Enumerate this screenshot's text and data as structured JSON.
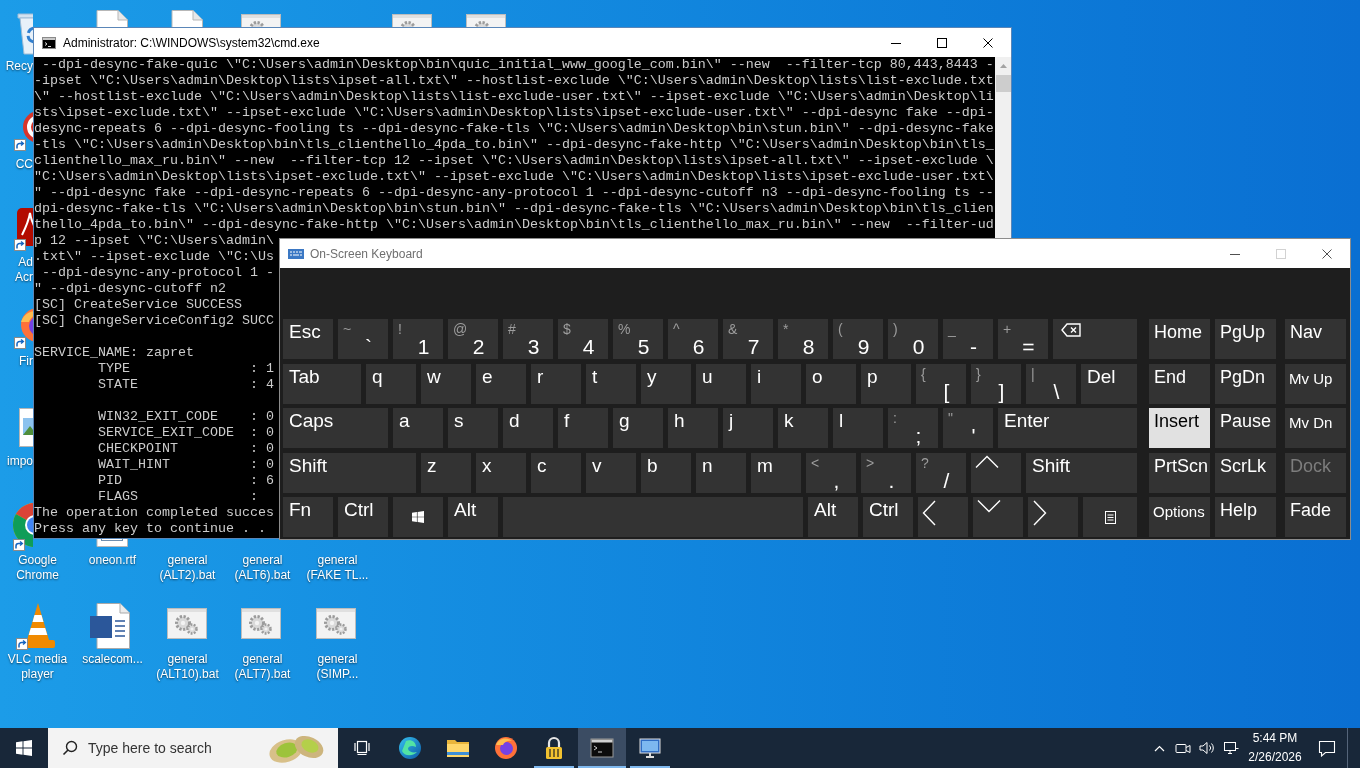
{
  "desktop": {
    "icons": [
      {
        "label": "Recy"
      },
      {
        "label": "CC"
      },
      {
        "label": "Ad Acr"
      },
      {
        "label": "Fir"
      },
      {
        "label": "impo"
      },
      {
        "label": "Google Chrome"
      },
      {
        "label": "VLC media player"
      },
      {
        "label": "oneon.rtf"
      },
      {
        "label": "scalecom..."
      },
      {
        "label": "general (ALT2).bat"
      },
      {
        "label": "general (ALT10).bat"
      },
      {
        "label": "general (ALT6).bat"
      },
      {
        "label": "general (ALT7).bat"
      },
      {
        "label": "general (FAKE TL..."
      },
      {
        "label": "general (SIMP..."
      }
    ]
  },
  "console_window": {
    "title": "Administrator: C:\\WINDOWS\\system32\\cmd.exe",
    "blocks": [
      [
        " --dpi-desync-fake-quic \\\"C:\\Users\\admin\\Desktop\\bin\\quic_initial_www_google_com.bin\\\" --new  --filter-tcp 80,443,8443 -",
        "-ipset \\\"C:\\Users\\admin\\Desktop\\lists\\ipset-all.txt\\\" --hostlist-exclude \\\"C:\\Users\\admin\\Desktop\\lists\\list-exclude.txt",
        "\\\" --hostlist-exclude \\\"C:\\Users\\admin\\Desktop\\lists\\list-exclude-user.txt\\\" --ipset-exclude \\\"C:\\Users\\admin\\Desktop\\li",
        "sts\\ipset-exclude.txt\\\" --ipset-exclude \\\"C:\\Users\\admin\\Desktop\\lists\\ipset-exclude-user.txt\\\" --dpi-desync fake --dpi-",
        "desync-repeats 6 --dpi-desync-fooling ts --dpi-desync-fake-tls \\\"C:\\Users\\admin\\Desktop\\bin\\stun.bin\\\" --dpi-desync-fake",
        "-tls \\\"C:\\Users\\admin\\Desktop\\bin\\tls_clienthello_4pda_to.bin\\\" --dpi-desync-fake-http \\\"C:\\Users\\admin\\Desktop\\bin\\tls_",
        "clienthello_max_ru.bin\\\" --new  --filter-tcp 12 --ipset \\\"C:\\Users\\admin\\Desktop\\lists\\ipset-all.txt\\\" --ipset-exclude \\",
        "\"C:\\Users\\admin\\Desktop\\lists\\ipset-exclude.txt\\\" --ipset-exclude \\\"C:\\Users\\admin\\Desktop\\lists\\ipset-exclude-user.txt\\",
        "\" --dpi-desync fake --dpi-desync-repeats 6 --dpi-desync-any-protocol 1 --dpi-desync-cutoff n3 --dpi-desync-fooling ts --",
        "dpi-desync-fake-tls \\\"C:\\Users\\admin\\Desktop\\bin\\stun.bin\\\" --dpi-desync-fake-tls \\\"C:\\Users\\admin\\Desktop\\bin\\tls_clien",
        "thello_4pda_to.bin\\\" --dpi-desync-fake-http \\\"C:\\Users\\admin\\Desktop\\bin\\tls_clienthello_max_ru.bin\\\" --new  --filter-ud",
        "p 12 --ipset \\\"C:\\Users\\admin\\",
        ".txt\\\" --ipset-exclude \\\"C:\\Us",
        " --dpi-desync-any-protocol 1 -",
        "\" --dpi-desync-cutoff n2",
        "[SC] CreateService SUCCESS",
        "[SC] ChangeServiceConfig2 SUCC"
      ],
      [
        "SERVICE_NAME: zapret",
        "        TYPE               : 1",
        "        STATE              : 4"
      ],
      [
        "        WIN32_EXIT_CODE    : 0",
        "        SERVICE_EXIT_CODE  : 0",
        "        CHECKPOINT         : 0",
        "        WAIT_HINT          : 0",
        "        PID                : 6",
        "        FLAGS              :",
        "The operation completed succes",
        "Press any key to continue . ."
      ]
    ]
  },
  "keyboard_window": {
    "title": "On-Screen Keyboard",
    "window_buttons": [
      {
        "kind": "minimize",
        "disabled": false
      },
      {
        "kind": "maximize",
        "disabled": true
      },
      {
        "kind": "close",
        "disabled": false
      }
    ],
    "key_rows": [
      [
        {
          "kind": "text",
          "label": "Esc"
        },
        {
          "kind": "dual",
          "shift": "~",
          "label": "`"
        },
        {
          "kind": "dual",
          "shift": "!",
          "label": "1"
        },
        {
          "kind": "dual",
          "shift": "@",
          "label": "2"
        },
        {
          "kind": "dual",
          "shift": "#",
          "label": "3"
        },
        {
          "kind": "dual",
          "shift": "$",
          "label": "4"
        },
        {
          "kind": "dual",
          "shift": "%",
          "label": "5"
        },
        {
          "kind": "dual",
          "shift": "^",
          "label": "6"
        },
        {
          "kind": "dual",
          "shift": "&",
          "label": "7"
        },
        {
          "kind": "dual",
          "shift": "*",
          "label": "8"
        },
        {
          "kind": "dual",
          "shift": "(",
          "label": "9"
        },
        {
          "kind": "dual",
          "shift": ")",
          "label": "0"
        },
        {
          "kind": "dual",
          "shift": "_",
          "label": "-"
        },
        {
          "kind": "dual",
          "shift": "+",
          "label": "="
        },
        {
          "kind": "backspace"
        }
      ],
      [
        {
          "kind": "text",
          "label": "Tab"
        },
        {
          "kind": "text",
          "label": "q"
        },
        {
          "kind": "text",
          "label": "w"
        },
        {
          "kind": "text",
          "label": "e"
        },
        {
          "kind": "text",
          "label": "r"
        },
        {
          "kind": "text",
          "label": "t"
        },
        {
          "kind": "text",
          "label": "y"
        },
        {
          "kind": "text",
          "label": "u"
        },
        {
          "kind": "text",
          "label": "i"
        },
        {
          "kind": "text",
          "label": "o"
        },
        {
          "kind": "text",
          "label": "p"
        },
        {
          "kind": "dual",
          "shift": "{",
          "label": "["
        },
        {
          "kind": "dual",
          "shift": "}",
          "label": "]"
        },
        {
          "kind": "dual",
          "shift": "|",
          "label": "\\"
        },
        {
          "kind": "text",
          "label": "Del"
        }
      ],
      [
        {
          "kind": "text",
          "label": "Caps"
        },
        {
          "kind": "text",
          "label": "a"
        },
        {
          "kind": "text",
          "label": "s"
        },
        {
          "kind": "text",
          "label": "d"
        },
        {
          "kind": "text",
          "label": "f"
        },
        {
          "kind": "text",
          "label": "g"
        },
        {
          "kind": "text",
          "label": "h"
        },
        {
          "kind": "text",
          "label": "j"
        },
        {
          "kind": "text",
          "label": "k"
        },
        {
          "kind": "text",
          "label": "l"
        },
        {
          "kind": "dual",
          "shift": ":",
          "label": ";"
        },
        {
          "kind": "dual",
          "shift": "\"",
          "label": "'"
        },
        {
          "kind": "text",
          "label": "Enter"
        }
      ],
      [
        {
          "kind": "text",
          "label": "Shift"
        },
        {
          "kind": "text",
          "label": "z"
        },
        {
          "kind": "text",
          "label": "x"
        },
        {
          "kind": "text",
          "label": "c"
        },
        {
          "kind": "text",
          "label": "v"
        },
        {
          "kind": "text",
          "label": "b"
        },
        {
          "kind": "text",
          "label": "n"
        },
        {
          "kind": "text",
          "label": "m"
        },
        {
          "kind": "dual",
          "shift": "<",
          "label": ","
        },
        {
          "kind": "dual",
          "shift": ">",
          "label": "."
        },
        {
          "kind": "dual",
          "shift": "?",
          "label": "/"
        },
        {
          "kind": "up"
        },
        {
          "kind": "text",
          "label": "Shift"
        }
      ],
      [
        {
          "kind": "text",
          "label": "Fn"
        },
        {
          "kind": "text",
          "label": "Ctrl"
        },
        {
          "kind": "windows"
        },
        {
          "kind": "text",
          "label": "Alt"
        },
        {
          "kind": "space"
        },
        {
          "kind": "text",
          "label": "Alt"
        },
        {
          "kind": "text",
          "label": "Ctrl"
        },
        {
          "kind": "left"
        },
        {
          "kind": "down"
        },
        {
          "kind": "right"
        },
        {
          "kind": "menu"
        }
      ]
    ],
    "nav_key_rows": [
      [
        {
          "kind": "text",
          "label": "Home",
          "highlighted": false,
          "disabled": false
        },
        {
          "kind": "text",
          "label": "PgUp",
          "highlighted": false,
          "disabled": false
        },
        {
          "kind": "text",
          "label": "Nav",
          "highlighted": false,
          "disabled": false
        }
      ],
      [
        {
          "kind": "text",
          "label": "End",
          "highlighted": false,
          "disabled": false
        },
        {
          "kind": "text",
          "label": "PgDn",
          "highlighted": false,
          "disabled": false
        },
        {
          "kind": "small",
          "label": "Mv Up",
          "highlighted": false,
          "disabled": false
        }
      ],
      [
        {
          "kind": "text",
          "label": "Insert",
          "highlighted": true,
          "disabled": false
        },
        {
          "kind": "text",
          "label": "Pause",
          "highlighted": false,
          "disabled": false
        },
        {
          "kind": "small",
          "label": "Mv Dn",
          "highlighted": false,
          "disabled": false
        }
      ],
      [
        {
          "kind": "text",
          "label": "PrtScn",
          "highlighted": false,
          "disabled": false
        },
        {
          "kind": "text",
          "label": "ScrLk",
          "highlighted": false,
          "disabled": false
        },
        {
          "kind": "text",
          "label": "Dock",
          "highlighted": false,
          "disabled": true
        }
      ],
      [
        {
          "kind": "small",
          "label": "Options",
          "highlighted": false,
          "disabled": false
        },
        {
          "kind": "text",
          "label": "Help",
          "highlighted": false,
          "disabled": false
        },
        {
          "kind": "text",
          "label": "Fade",
          "highlighted": false,
          "disabled": false
        }
      ]
    ]
  },
  "taskbar": {
    "search": {
      "placeholder": "Type here to search"
    },
    "apps": [
      {
        "running": false,
        "active": false
      },
      {
        "running": false,
        "active": false
      },
      {
        "running": false,
        "active": false
      },
      {
        "running": true,
        "active": false
      },
      {
        "running": true,
        "active": true
      },
      {
        "running": true,
        "active": false
      }
    ],
    "clock": {
      "time": "5:44 PM",
      "date": "2/26/2026"
    }
  }
}
